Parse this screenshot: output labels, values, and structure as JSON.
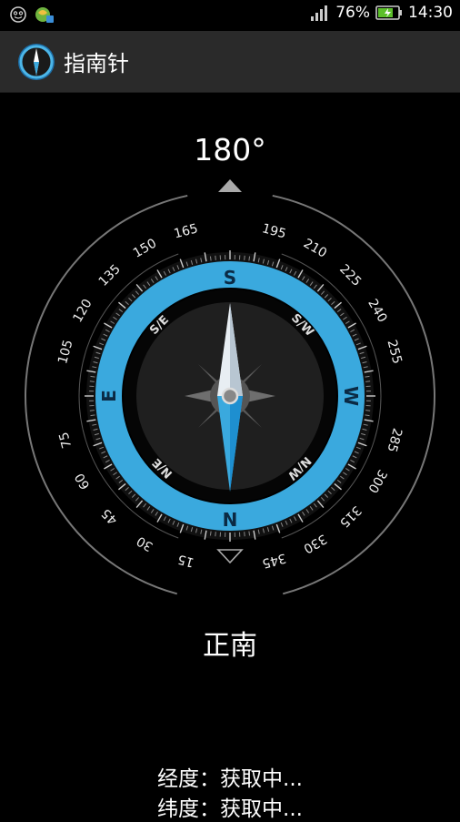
{
  "status_bar": {
    "battery_percent": "76%",
    "time": "14:30",
    "battery_level": 0.76,
    "icons": [
      "emoji-icon",
      "app-notification-icon",
      "signal-icon",
      "battery-charging-icon"
    ]
  },
  "app_bar": {
    "title": "指南针",
    "icon": "compass-app-icon"
  },
  "compass": {
    "heading_text": "180°",
    "heading_value": 180,
    "cardinals": {
      "n": "N",
      "s": "S",
      "e": "E",
      "w": "W"
    },
    "intercardinals": {
      "se": "S/E",
      "sw": "S/W",
      "ne": "N/E",
      "nw": "N/W"
    },
    "degree_labels": [
      "15",
      "30",
      "45",
      "60",
      "75",
      "105",
      "120",
      "135",
      "150",
      "165",
      "195",
      "210",
      "225",
      "240",
      "255",
      "285",
      "300",
      "315",
      "330",
      "345"
    ],
    "ring_color": "#3aa9de",
    "accent_color": "#1e8fd0"
  },
  "direction_text": "正南",
  "location": {
    "longitude_label": "经度：",
    "longitude_value": "获取中...",
    "latitude_label": "纬度：",
    "latitude_value": "获取中..."
  }
}
